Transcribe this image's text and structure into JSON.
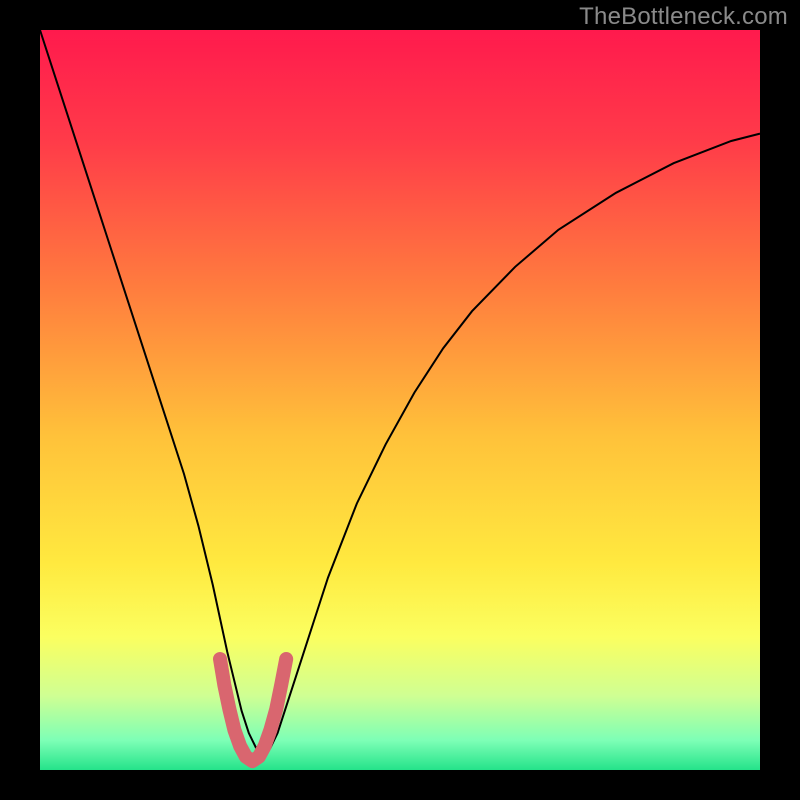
{
  "watermark": "TheBottleneck.com",
  "chart_data": {
    "type": "line",
    "title": "",
    "xlabel": "",
    "ylabel": "",
    "xlim": [
      0,
      100
    ],
    "ylim": [
      0,
      100
    ],
    "background": {
      "type": "vertical-gradient",
      "stops": [
        {
          "pos": 0.0,
          "color": "#ff1a4d"
        },
        {
          "pos": 0.15,
          "color": "#ff3b49"
        },
        {
          "pos": 0.35,
          "color": "#ff7d3e"
        },
        {
          "pos": 0.55,
          "color": "#ffc23a"
        },
        {
          "pos": 0.72,
          "color": "#ffe93f"
        },
        {
          "pos": 0.82,
          "color": "#fbff60"
        },
        {
          "pos": 0.9,
          "color": "#cfff93"
        },
        {
          "pos": 0.96,
          "color": "#7dffb6"
        },
        {
          "pos": 1.0,
          "color": "#24e38a"
        }
      ]
    },
    "series": [
      {
        "name": "bottleneck-curve",
        "color": "#000000",
        "stroke_width": 2,
        "x": [
          0,
          2,
          4,
          6,
          8,
          10,
          12,
          14,
          16,
          18,
          20,
          22,
          24,
          26,
          27,
          28,
          29,
          30,
          31,
          32,
          33,
          34,
          36,
          38,
          40,
          44,
          48,
          52,
          56,
          60,
          66,
          72,
          80,
          88,
          96,
          100
        ],
        "values": [
          100,
          94,
          88,
          82,
          76,
          70,
          64,
          58,
          52,
          46,
          40,
          33,
          25,
          16,
          12,
          8,
          5,
          3,
          2,
          3,
          5,
          8,
          14,
          20,
          26,
          36,
          44,
          51,
          57,
          62,
          68,
          73,
          78,
          82,
          85,
          86
        ]
      },
      {
        "name": "optimal-zone",
        "color": "#d9666f",
        "stroke_width": 14,
        "linecap": "round",
        "x": [
          25.0,
          25.6,
          26.3,
          27.0,
          27.8,
          28.6,
          29.5,
          30.4,
          31.2,
          32.0,
          32.8,
          33.5,
          34.2
        ],
        "values": [
          15.0,
          11.5,
          8.2,
          5.4,
          3.2,
          1.8,
          1.2,
          1.8,
          3.2,
          5.4,
          8.2,
          11.5,
          15.0
        ]
      }
    ]
  }
}
